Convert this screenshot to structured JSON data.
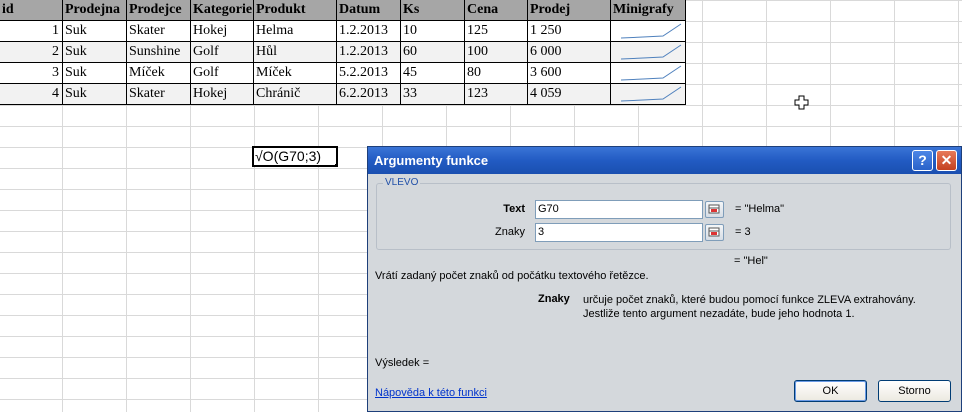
{
  "sheet": {
    "headers": [
      "id",
      "Prodejna",
      "Prodejce",
      "Kategorie",
      "Produkt",
      "Datum",
      "Ks",
      "Cena",
      "Prodej",
      "Minigrafy"
    ],
    "rows": [
      {
        "id": "1",
        "prodejna": "Suk",
        "prodejce": "Skater",
        "kategorie": "Hokej",
        "produkt": "Helma",
        "datum": "1.2.2013",
        "ks": "10",
        "cena": "125",
        "prodej": "1 250"
      },
      {
        "id": "2",
        "prodejna": "Suk",
        "prodejce": "Sunshine",
        "kategorie": "Golf",
        "produkt": "Hůl",
        "datum": "1.2.2013",
        "ks": "60",
        "cena": "100",
        "prodej": "6 000"
      },
      {
        "id": "3",
        "prodejna": "Suk",
        "prodejce": "Míček",
        "kategorie": "Golf",
        "produkt": "Míček",
        "datum": "5.2.2013",
        "ks": "45",
        "cena": "80",
        "prodej": "3 600"
      },
      {
        "id": "4",
        "prodejna": "Suk",
        "prodejce": "Skater",
        "kategorie": "Hokej",
        "produkt": "Chránič",
        "datum": "6.2.2013",
        "ks": "33",
        "cena": "123",
        "prodej": "4 059"
      }
    ],
    "active_cell_text": "√O(G70;3)",
    "sparkline_color": "#4f81bd"
  },
  "dialog": {
    "title": "Argumenty funkce",
    "help_icon": "?",
    "close_icon": "✕",
    "function_name": "VLEVO",
    "args": [
      {
        "label": "Text",
        "value": "G70",
        "result": "= \"Helma\""
      },
      {
        "label": "Znaky",
        "value": "3",
        "result": "= 3"
      }
    ],
    "function_result": "= \"Hel\"",
    "description": "Vrátí zadaný počet znaků od počátku textového řetězce.",
    "arg_help_name": "Znaky",
    "arg_help_text": "určuje počet znaků, které budou pomocí funkce ZLEVA extrahovány. Jestliže tento argument nezadáte, bude jeho hodnota 1.",
    "result_label": "Výsledek =",
    "help_link": "Nápověda k této funkci",
    "ok_label": "OK",
    "cancel_label": "Storno",
    "titlebar_color": "#225bc3"
  }
}
